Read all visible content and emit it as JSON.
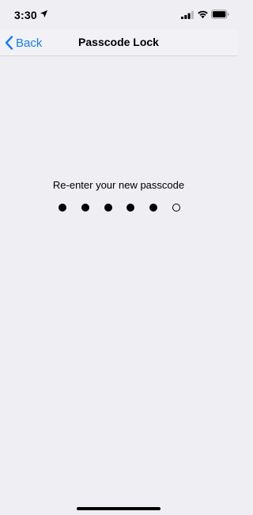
{
  "status_bar": {
    "time": "3:30",
    "location_icon": "location-arrow-icon",
    "signal_icon": "cellular-signal-icon",
    "wifi_icon": "wifi-icon",
    "battery_icon": "battery-icon"
  },
  "nav": {
    "back_label": "Back",
    "title": "Passcode Lock",
    "accent_color": "#147EFB"
  },
  "passcode": {
    "prompt": "Re-enter your new passcode",
    "length": 6,
    "entered": 5
  }
}
